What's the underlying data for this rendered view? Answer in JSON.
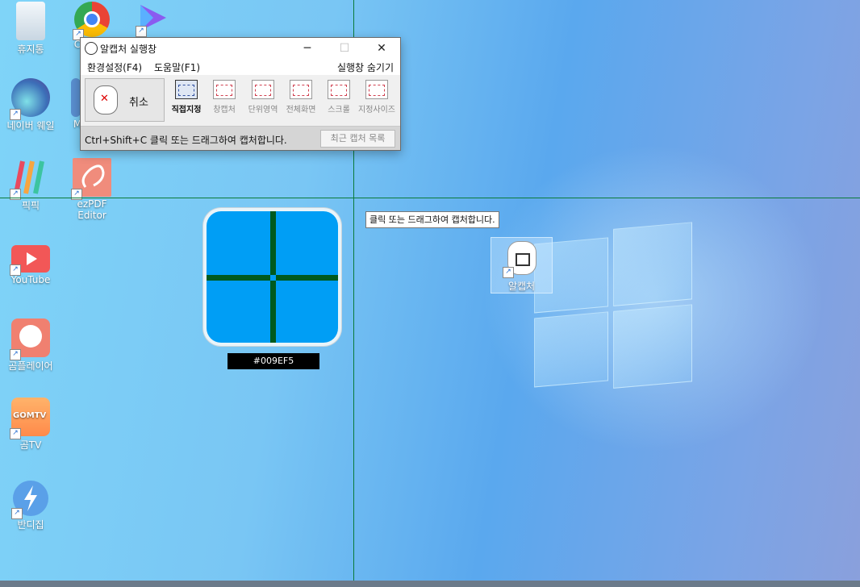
{
  "desktop": {
    "icons": [
      {
        "label": "휴지통",
        "name": "recycle-bin"
      },
      {
        "label": "C",
        "name": "chrome"
      },
      {
        "label": "",
        "name": "media-player"
      },
      {
        "label": "네이버 웨일",
        "name": "naver-whale"
      },
      {
        "label": "M",
        "name": "m-app"
      },
      {
        "label": "픽픽",
        "name": "picpick"
      },
      {
        "label": "ezPDF Editor",
        "name": "ezpdf-editor"
      },
      {
        "label": "YouTube",
        "name": "youtube"
      },
      {
        "label": "곰플레이어",
        "name": "gom-player"
      },
      {
        "label": "곰TV",
        "name": "gom-tv"
      },
      {
        "label": "반디집",
        "name": "bandizip"
      },
      {
        "label": "알캡처",
        "name": "alcapture"
      }
    ],
    "gomtv_logo_text": "GOMTV"
  },
  "capture_window": {
    "title": "알캡처 실행창",
    "minimize": "─",
    "maximize": "☐",
    "close": "✕",
    "menu": {
      "settings": "환경설정(F4)",
      "help": "도움말(F1)",
      "hide": "실행창 숨기기"
    },
    "cancel_label": "취소",
    "tools": [
      "직접지정",
      "창캡처",
      "단위영역",
      "전체화면",
      "스크롤",
      "지정사이즈"
    ],
    "status_text": "Ctrl+Shift+C 클릭 또는 드래그하여 캡처합니다.",
    "recent_button": "최근 캡처 목록"
  },
  "magnifier": {
    "hex": "#009EF5",
    "color": "#009ef5",
    "crosshair_color": "#005a1e"
  },
  "tooltip": "클릭 또는 드래그하여 캡처합니다.",
  "colors": {
    "crosshair": "#0a7a3a",
    "accent": "#009ef5"
  }
}
